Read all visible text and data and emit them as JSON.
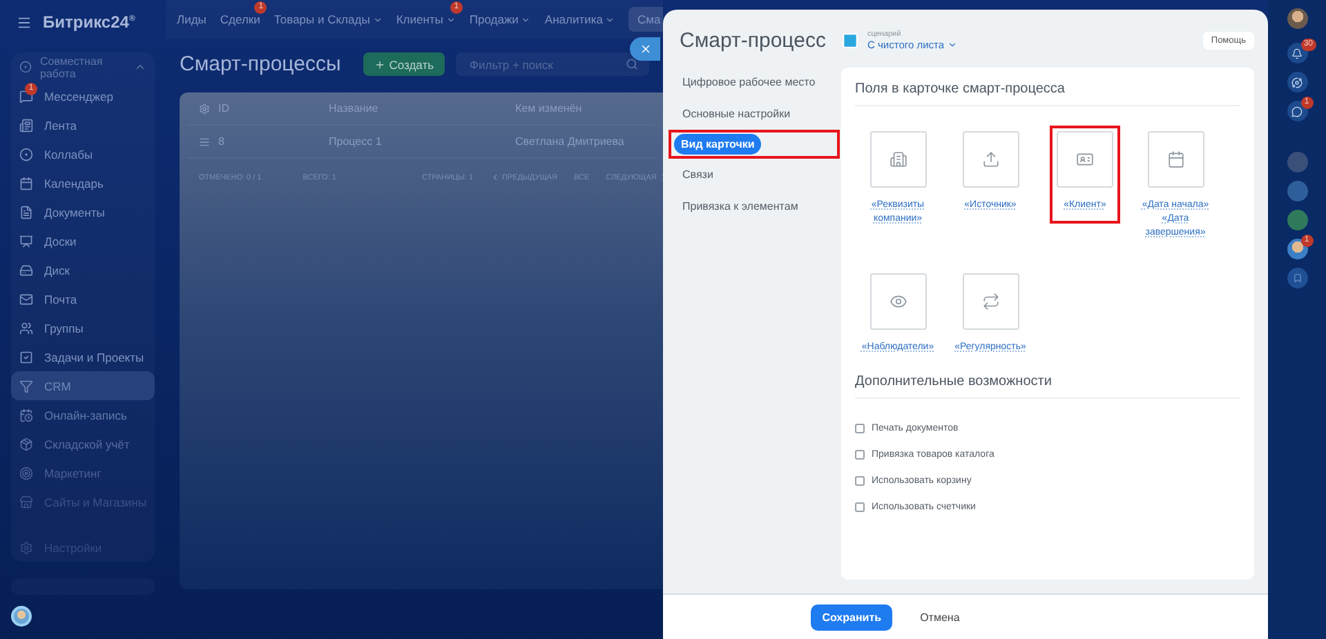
{
  "logo": {
    "name": "Битрикс24",
    "mark": "®"
  },
  "top_nav": [
    {
      "label": "Лиды",
      "dropdown": false
    },
    {
      "label": "Сделки",
      "badge": "1",
      "dropdown": false
    },
    {
      "label": "Товары и Склады",
      "dropdown": true
    },
    {
      "label": "Клиенты",
      "badge": "1",
      "dropdown": true
    },
    {
      "label": "Продажи",
      "dropdown": true
    },
    {
      "label": "Аналитика",
      "dropdown": true
    },
    {
      "label": "Сма",
      "dropdown": false
    }
  ],
  "sidebar": {
    "group": "Совместная работа",
    "items": [
      {
        "label": "Мессенджер",
        "selected": false,
        "badge": "1"
      },
      {
        "label": "Лента",
        "selected": false
      },
      {
        "label": "Коллабы",
        "selected": false
      },
      {
        "label": "Календарь",
        "selected": false
      },
      {
        "label": "Документы",
        "selected": false
      },
      {
        "label": "Доски",
        "selected": false
      },
      {
        "label": "Диск",
        "selected": false
      },
      {
        "label": "Почта",
        "selected": false
      },
      {
        "label": "Группы",
        "selected": false
      },
      {
        "label": "Задачи и Проекты",
        "selected": false
      },
      {
        "label": "CRM",
        "selected": true
      },
      {
        "label": "Онлайн-запись",
        "selected": false
      },
      {
        "label": "Складской учёт",
        "selected": false
      },
      {
        "label": "Маркетинг",
        "selected": false
      },
      {
        "label": "Сайты и Магазины",
        "selected": false
      },
      {
        "label": "Настройки",
        "selected": false
      }
    ]
  },
  "page": {
    "title": "Смарт-процессы",
    "create_button": "Создать",
    "search": {
      "placeholder": "Фильтр + поиск"
    }
  },
  "table": {
    "columns": [
      "ID",
      "Название",
      "Кем изменён"
    ],
    "rows": [
      [
        "8",
        "Процесс 1",
        "Светлана Дмитриева"
      ]
    ],
    "footer": {
      "checked": "ОТМЕЧЕНО: 0 / 1",
      "total": "ВСЕГО: 1",
      "pages": "СТРАНИЦЫ: 1",
      "prev": "ПРЕДЫДУЩАЯ",
      "all": "ВСЕ",
      "next": "СЛЕДУЮЩАЯ"
    }
  },
  "panel": {
    "title": "Смарт-процесс",
    "nav": [
      {
        "label": "Цифровое рабочее место",
        "selected": false,
        "highlighted": false
      },
      {
        "label": "Основные настройки",
        "selected": false,
        "highlighted": false
      },
      {
        "label": "Вид карточки",
        "selected": true,
        "highlighted": true
      },
      {
        "label": "Связи",
        "selected": false,
        "highlighted": false
      },
      {
        "label": "Привязка к элементам",
        "selected": false,
        "highlighted": false
      }
    ],
    "scenario": {
      "caption": "сценарий",
      "value": "С чистого листа"
    },
    "help_button": "Помощь",
    "fields_section": {
      "title": "Поля в карточке смарт-процесса",
      "tiles": [
        {
          "label": "«Реквизиты компании»",
          "highlighted": false
        },
        {
          "label": "«Источник»",
          "highlighted": false
        },
        {
          "label": "«Клиент»",
          "highlighted": true
        },
        {
          "label": "«Дата начала» «Дата завершения»",
          "highlighted": false
        },
        {
          "label": "«Наблюдатели»",
          "highlighted": false
        },
        {
          "label": "«Регулярность»",
          "highlighted": false
        }
      ]
    },
    "extra_section": {
      "title": "Дополнительные возможности",
      "options": [
        {
          "label": "Печать документов",
          "checked": false
        },
        {
          "label": "Привязка товаров каталога",
          "checked": false
        },
        {
          "label": "Использовать корзину",
          "checked": false
        },
        {
          "label": "Использовать счетчики",
          "checked": false
        }
      ]
    },
    "save_button": "Сохранить",
    "cancel_button": "Отмена"
  },
  "right_rail": {
    "notifications_badge": "30",
    "chat_badge": "1",
    "contact_badge": "1"
  }
}
